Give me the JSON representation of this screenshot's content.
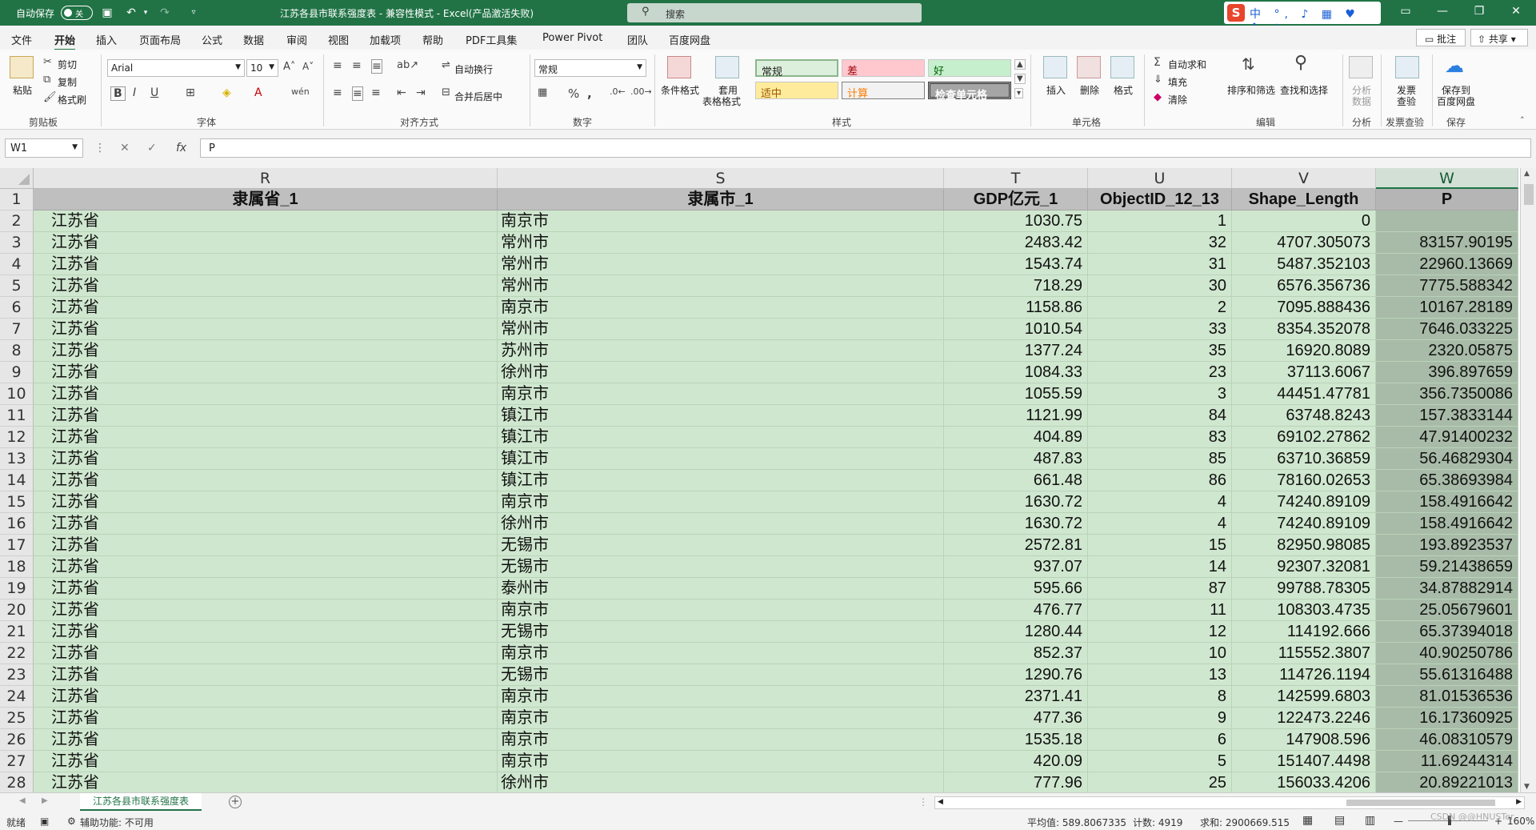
{
  "titlebar": {
    "autosave_label": "自动保存",
    "autosave_state": "关",
    "doc_title": "江苏各县市联系强度表  -  兼容性模式  -  Excel(产品激活失败)",
    "search_placeholder": "搜索",
    "ime_brand": "S",
    "ime_text": "中 °, ♪ ▦ ♥ ✣ ✦"
  },
  "menu": {
    "tabs": [
      "文件",
      "开始",
      "插入",
      "页面布局",
      "公式",
      "数据",
      "审阅",
      "视图",
      "加载项",
      "帮助",
      "PDF工具集",
      "Power Pivot",
      "团队",
      "百度网盘"
    ],
    "annotate": "批注",
    "share": "共享"
  },
  "ribbon": {
    "clipboard": {
      "paste": "粘贴",
      "cut": "剪切",
      "copy": "复制",
      "format_painter": "格式刷",
      "label": "剪贴板"
    },
    "font": {
      "name": "Arial",
      "size": "10",
      "label": "字体"
    },
    "alignment": {
      "wrap": "自动换行",
      "merge": "合并后居中",
      "label": "对齐方式"
    },
    "number": {
      "format": "常规",
      "label": "数字"
    },
    "styles": {
      "cond_format": "条件格式",
      "table_format_1": "套用",
      "table_format_2": "表格格式",
      "normal": "常规",
      "bad": "差",
      "good": "好",
      "neutral": "适中",
      "calc": "计算",
      "check": "检查单元格",
      "label": "样式"
    },
    "cells": {
      "insert": "插入",
      "delete": "删除",
      "format": "格式",
      "label": "单元格"
    },
    "editing": {
      "autosum": "自动求和",
      "fill": "填充",
      "clear": "清除",
      "sort": "排序和筛选",
      "find": "查找和选择",
      "label": "编辑"
    },
    "analysis": {
      "analyze_1": "分析",
      "analyze_2": "数据",
      "label": "分析"
    },
    "invoice": {
      "check_1": "发票",
      "check_2": "查验",
      "label": "发票查验"
    },
    "save": {
      "save_1": "保存到",
      "save_2": "百度网盘",
      "label": "保存"
    }
  },
  "formula_bar": {
    "name_box": "W1",
    "content": "P"
  },
  "columns": [
    {
      "letter": "R",
      "header": "隶属省_1"
    },
    {
      "letter": "S",
      "header": "隶属市_1"
    },
    {
      "letter": "T",
      "header": "GDP亿元_1"
    },
    {
      "letter": "U",
      "header": "ObjectID_12_13"
    },
    {
      "letter": "V",
      "header": "Shape_Length"
    },
    {
      "letter": "W",
      "header": "P"
    }
  ],
  "rows": [
    {
      "n": "2",
      "c": [
        "江苏省",
        "南京市",
        "1030.75",
        "1",
        "0",
        ""
      ]
    },
    {
      "n": "3",
      "c": [
        "江苏省",
        "常州市",
        "2483.42",
        "32",
        "4707.305073",
        "83157.90195"
      ]
    },
    {
      "n": "4",
      "c": [
        "江苏省",
        "常州市",
        "1543.74",
        "31",
        "5487.352103",
        "22960.13669"
      ]
    },
    {
      "n": "5",
      "c": [
        "江苏省",
        "常州市",
        "718.29",
        "30",
        "6576.356736",
        "7775.588342"
      ]
    },
    {
      "n": "6",
      "c": [
        "江苏省",
        "南京市",
        "1158.86",
        "2",
        "7095.888436",
        "10167.28189"
      ]
    },
    {
      "n": "7",
      "c": [
        "江苏省",
        "常州市",
        "1010.54",
        "33",
        "8354.352078",
        "7646.033225"
      ]
    },
    {
      "n": "8",
      "c": [
        "江苏省",
        "苏州市",
        "1377.24",
        "35",
        "16920.8089",
        "2320.05875"
      ]
    },
    {
      "n": "9",
      "c": [
        "江苏省",
        "徐州市",
        "1084.33",
        "23",
        "37113.6067",
        "396.897659"
      ]
    },
    {
      "n": "10",
      "c": [
        "江苏省",
        "南京市",
        "1055.59",
        "3",
        "44451.47781",
        "356.7350086"
      ]
    },
    {
      "n": "11",
      "c": [
        "江苏省",
        "镇江市",
        "1121.99",
        "84",
        "63748.8243",
        "157.3833144"
      ]
    },
    {
      "n": "12",
      "c": [
        "江苏省",
        "镇江市",
        "404.89",
        "83",
        "69102.27862",
        "47.91400232"
      ]
    },
    {
      "n": "13",
      "c": [
        "江苏省",
        "镇江市",
        "487.83",
        "85",
        "63710.36859",
        "56.46829304"
      ]
    },
    {
      "n": "14",
      "c": [
        "江苏省",
        "镇江市",
        "661.48",
        "86",
        "78160.02653",
        "65.38693984"
      ]
    },
    {
      "n": "15",
      "c": [
        "江苏省",
        "南京市",
        "1630.72",
        "4",
        "74240.89109",
        "158.4916642"
      ]
    },
    {
      "n": "16",
      "c": [
        "江苏省",
        "徐州市",
        "1630.72",
        "4",
        "74240.89109",
        "158.4916642"
      ]
    },
    {
      "n": "17",
      "c": [
        "江苏省",
        "无锡市",
        "2572.81",
        "15",
        "82950.98085",
        "193.8923537"
      ]
    },
    {
      "n": "18",
      "c": [
        "江苏省",
        "无锡市",
        "937.07",
        "14",
        "92307.32081",
        "59.21438659"
      ]
    },
    {
      "n": "19",
      "c": [
        "江苏省",
        "泰州市",
        "595.66",
        "87",
        "99788.78305",
        "34.87882914"
      ]
    },
    {
      "n": "20",
      "c": [
        "江苏省",
        "南京市",
        "476.77",
        "11",
        "108303.4735",
        "25.05679601"
      ]
    },
    {
      "n": "21",
      "c": [
        "江苏省",
        "无锡市",
        "1280.44",
        "12",
        "114192.666",
        "65.37394018"
      ]
    },
    {
      "n": "22",
      "c": [
        "江苏省",
        "南京市",
        "852.37",
        "10",
        "115552.3807",
        "40.90250786"
      ]
    },
    {
      "n": "23",
      "c": [
        "江苏省",
        "无锡市",
        "1290.76",
        "13",
        "114726.1194",
        "55.61316488"
      ]
    },
    {
      "n": "24",
      "c": [
        "江苏省",
        "南京市",
        "2371.41",
        "8",
        "142599.6803",
        "81.01536536"
      ]
    },
    {
      "n": "25",
      "c": [
        "江苏省",
        "南京市",
        "477.36",
        "9",
        "122473.2246",
        "16.17360925"
      ]
    },
    {
      "n": "26",
      "c": [
        "江苏省",
        "南京市",
        "1535.18",
        "6",
        "147908.596",
        "46.08310579"
      ]
    },
    {
      "n": "27",
      "c": [
        "江苏省",
        "南京市",
        "420.09",
        "5",
        "151407.4498",
        "11.69244314"
      ]
    },
    {
      "n": "28",
      "c": [
        "江苏省",
        "徐州市",
        "777.96",
        "25",
        "156033.4206",
        "20.89221013"
      ]
    }
  ],
  "sheet": {
    "tab": "江苏各县市联系强度表"
  },
  "status": {
    "ready": "就绪",
    "accessibility": "辅助功能: 不可用",
    "average": "平均值: 589.8067335",
    "count": "计数: 4919",
    "sum": "求和: 2900669.515",
    "zoom": "160%",
    "watermark": "CSDN @@HNUSTer"
  }
}
